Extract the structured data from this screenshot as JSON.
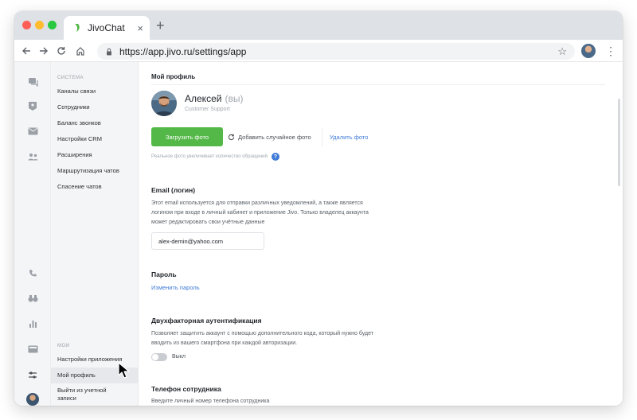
{
  "browser": {
    "tab_title": "JivoChat",
    "tab_close": "×",
    "new_tab": "+",
    "url": "https://app.jivo.ru/settings/app",
    "icons": [
      "back-icon",
      "forward-icon",
      "reload-icon",
      "home-icon",
      "lock-icon",
      "star-icon",
      "kebab-icon"
    ]
  },
  "submenu": {
    "section_system": "СИСТЕМА",
    "system_items": [
      "Каналы связи",
      "Сотрудники",
      "Баланс звонков",
      "Настройки CRM",
      "Расширения",
      "Маршрутизация чатов",
      "Спасение чатов"
    ],
    "section_my": "МОИ",
    "my_items": [
      "Настройки приложения",
      "Мой профиль",
      "Выйти из учетной записи"
    ],
    "active_item": "Мой профиль"
  },
  "iconbar": {
    "icons": [
      "chats-icon",
      "contacts-icon",
      "mail-icon",
      "team-icon",
      "phone-icon",
      "binoculars-icon",
      "stats-icon",
      "inbox-icon",
      "settings-icon",
      "avatar-icon"
    ]
  },
  "profile": {
    "page_title": "Мой профиль",
    "name": "Алексей",
    "you_label": "(вы)",
    "role": "Customer Support",
    "upload_button": "Загрузить фото",
    "random_button": "Добавить случайное фото",
    "delete_button": "Удалить фото",
    "photo_hint": "Реальное фото увеличивает количество обращений",
    "help": "?"
  },
  "email": {
    "title": "Email (логин)",
    "desc_lines": [
      "Этот email используется для отправки различных уведомлений, а также является",
      "логином при входе в личный кабинет и приложение Jivo. Только владелец аккаунта",
      "может редактировать свои учётные данные"
    ],
    "value": "alex-demin@yahoo.com"
  },
  "password": {
    "title": "Пароль",
    "change_link": "Изменить пароль"
  },
  "twofa": {
    "title": "Двухфакторная аутентификация",
    "desc_lines": [
      "Позволяет защитить аккаунт с помощью дополнительного кода, который нужно будет",
      "вводить из вашего смартфона при каждой авторизации."
    ],
    "toggle_label": "Выкл",
    "enabled": false
  },
  "phone": {
    "title": "Телефон сотрудника",
    "desc": "Введите личный номер телефона сотрудника"
  },
  "colors": {
    "accent_green": "#54b848",
    "link_blue": "#3f7ad6"
  }
}
